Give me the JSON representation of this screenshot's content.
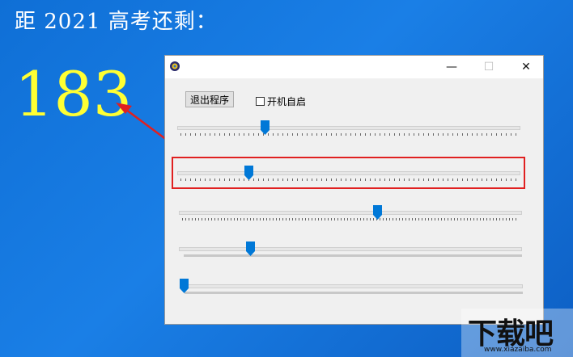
{
  "desktop": {
    "headline": "距 2021 高考还剩：",
    "days_remaining": "183",
    "text_color": "#ffffff",
    "number_color": "#ffff33",
    "arrow_color": "#e02020"
  },
  "window": {
    "icon": "app-globe-icon",
    "controls": {
      "minimize": "—",
      "maximize": "☐",
      "close": "✕"
    },
    "exit_button": "退出程序",
    "autostart_label": "开机自启",
    "autostart_checked": false,
    "highlight_color": "#e02020",
    "sliders": [
      {
        "name": "slider-1",
        "value": 0.25
      },
      {
        "name": "slider-2",
        "value": 0.2
      },
      {
        "name": "slider-3",
        "value": 0.58
      },
      {
        "name": "slider-4",
        "value": 0.2
      },
      {
        "name": "slider-5",
        "value": 0.0
      }
    ]
  },
  "watermark": {
    "logo": "下载吧",
    "url": "www.xiazaiba.com"
  }
}
